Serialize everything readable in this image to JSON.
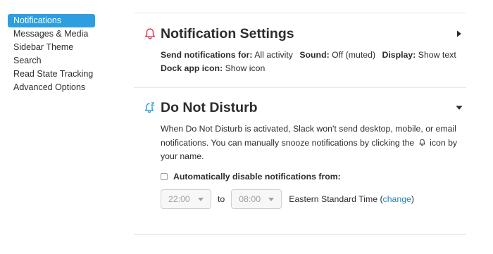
{
  "sidebar": {
    "items": [
      {
        "label": "Notifications",
        "active": true
      },
      {
        "label": "Messages & Media"
      },
      {
        "label": "Sidebar Theme"
      },
      {
        "label": "Search"
      },
      {
        "label": "Read State Tracking"
      },
      {
        "label": "Advanced Options"
      }
    ]
  },
  "notification_settings": {
    "title": "Notification Settings",
    "icon": "bell-icon",
    "toggle_icon": "caret-right-icon",
    "send_for_label": "Send notifications for:",
    "send_for_value": "All activity",
    "sound_label": "Sound:",
    "sound_value": "Off (muted)",
    "display_label": "Display:",
    "display_value": "Show text",
    "dock_label": "Dock app icon:",
    "dock_value": "Show icon"
  },
  "dnd": {
    "title": "Do Not Disturb",
    "icon": "bell-snooze-icon",
    "toggle_icon": "caret-down-icon",
    "desc_part1": "When Do Not Disturb is activated, Slack won't send desktop, mobile, or email notifications. You can manually snooze notifications by clicking the",
    "desc_part2": "icon by your name.",
    "checkbox_label": "Automatically disable notifications from:",
    "checkbox_checked": false,
    "from_time": "22:00",
    "to_label": "to",
    "to_time": "08:00",
    "timezone": "Eastern Standard Time (",
    "change_link": "change",
    "timezone_close": ")"
  },
  "colors": {
    "active_bg": "#2d9ee0",
    "bell_red": "#e0405a",
    "snooze_blue": "#2d9ee0",
    "link": "#2a80b9"
  }
}
